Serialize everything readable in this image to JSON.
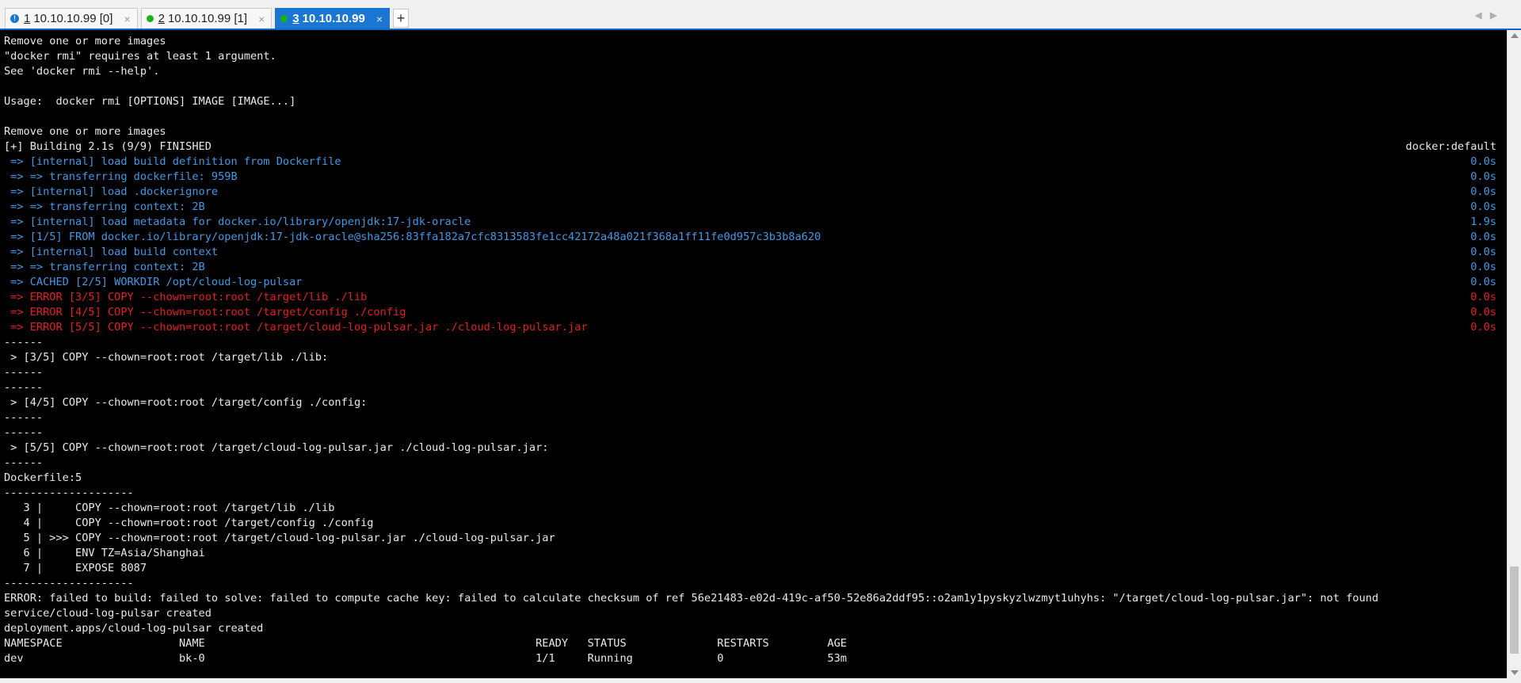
{
  "tabs": [
    {
      "num": "1",
      "title": "10.10.10.99 [0]",
      "active": false,
      "indicator": "warning-icon",
      "close": "×"
    },
    {
      "num": "2",
      "title": "10.10.10.99 [1]",
      "active": false,
      "indicator": "connected-dot-icon",
      "close": "×"
    },
    {
      "num": "3",
      "title": "10.10.10.99",
      "active": true,
      "indicator": "connected-dot-icon",
      "close": "×"
    }
  ],
  "new_tab_label": "+",
  "warning_glyph": "!",
  "nav_arrows": "◀▶",
  "colors": {
    "normal": "#eaeaea",
    "blue": "#3e9ae8",
    "red": "#e81e1e",
    "accent": "#1976d2",
    "connected": "#18b318"
  },
  "terminal": {
    "lines": [
      {
        "text": "Remove one or more images",
        "style": "normal"
      },
      {
        "text": "\"docker rmi\" requires at least 1 argument.",
        "style": "normal"
      },
      {
        "text": "See 'docker rmi --help'.",
        "style": "normal"
      },
      {
        "text": "",
        "style": "normal"
      },
      {
        "text": "Usage:  docker rmi [OPTIONS] IMAGE [IMAGE...]",
        "style": "normal"
      },
      {
        "text": "",
        "style": "normal"
      },
      {
        "text": "Remove one or more images",
        "style": "normal"
      },
      {
        "text": "[+] Building 2.1s (9/9) FINISHED",
        "right": "docker:default",
        "style": "normal"
      },
      {
        "text": " => [internal] load build definition from Dockerfile",
        "right": "0.0s",
        "style": "blue"
      },
      {
        "text": " => => transferring dockerfile: 959B",
        "right": "0.0s",
        "style": "blue"
      },
      {
        "text": " => [internal] load .dockerignore",
        "right": "0.0s",
        "style": "blue"
      },
      {
        "text": " => => transferring context: 2B",
        "right": "0.0s",
        "style": "blue"
      },
      {
        "text": " => [internal] load metadata for docker.io/library/openjdk:17-jdk-oracle",
        "right": "1.9s",
        "style": "blue"
      },
      {
        "text": " => [1/5] FROM docker.io/library/openjdk:17-jdk-oracle@sha256:83ffa182a7cfc8313583fe1cc42172a48a021f368a1ff11fe0d957c3b3b8a620",
        "right": "0.0s",
        "style": "blue"
      },
      {
        "text": " => [internal] load build context",
        "right": "0.0s",
        "style": "blue"
      },
      {
        "text": " => => transferring context: 2B",
        "right": "0.0s",
        "style": "blue"
      },
      {
        "text": " => CACHED [2/5] WORKDIR /opt/cloud-log-pulsar",
        "right": "0.0s",
        "style": "blue"
      },
      {
        "text": " => ERROR [3/5] COPY --chown=root:root /target/lib ./lib",
        "right": "0.0s",
        "style": "red"
      },
      {
        "text": " => ERROR [4/5] COPY --chown=root:root /target/config ./config",
        "right": "0.0s",
        "style": "red"
      },
      {
        "text": " => ERROR [5/5] COPY --chown=root:root /target/cloud-log-pulsar.jar ./cloud-log-pulsar.jar",
        "right": "0.0s",
        "style": "red"
      },
      {
        "text": "------",
        "style": "normal"
      },
      {
        "text": " > [3/5] COPY --chown=root:root /target/lib ./lib:",
        "style": "normal"
      },
      {
        "text": "------",
        "style": "normal"
      },
      {
        "text": "------",
        "style": "normal"
      },
      {
        "text": " > [4/5] COPY --chown=root:root /target/config ./config:",
        "style": "normal"
      },
      {
        "text": "------",
        "style": "normal"
      },
      {
        "text": "------",
        "style": "normal"
      },
      {
        "text": " > [5/5] COPY --chown=root:root /target/cloud-log-pulsar.jar ./cloud-log-pulsar.jar:",
        "style": "normal"
      },
      {
        "text": "------",
        "style": "normal"
      },
      {
        "text": "Dockerfile:5",
        "style": "normal"
      },
      {
        "text": "--------------------",
        "style": "normal"
      },
      {
        "text": "   3 |     COPY --chown=root:root /target/lib ./lib",
        "style": "normal"
      },
      {
        "text": "   4 |     COPY --chown=root:root /target/config ./config",
        "style": "normal"
      },
      {
        "text": "   5 | >>> COPY --chown=root:root /target/cloud-log-pulsar.jar ./cloud-log-pulsar.jar",
        "style": "normal"
      },
      {
        "text": "   6 |     ENV TZ=Asia/Shanghai",
        "style": "normal"
      },
      {
        "text": "   7 |     EXPOSE 8087",
        "style": "normal"
      },
      {
        "text": "--------------------",
        "style": "normal"
      },
      {
        "text": "ERROR: failed to build: failed to solve: failed to compute cache key: failed to calculate checksum of ref 56e21483-e02d-419c-af50-52e86a2ddf95::o2am1y1pyskyzlwzmyt1uhyhs: \"/target/cloud-log-pulsar.jar\": not found",
        "style": "normal"
      },
      {
        "text": "service/cloud-log-pulsar created",
        "style": "normal"
      },
      {
        "text": "deployment.apps/cloud-log-pulsar created",
        "style": "normal"
      },
      {
        "text": "NAMESPACE                  NAME                                                   READY   STATUS              RESTARTS         AGE",
        "style": "normal"
      },
      {
        "text": "dev                        bk-0                                                   1/1     Running             0                53m",
        "style": "normal"
      }
    ]
  }
}
